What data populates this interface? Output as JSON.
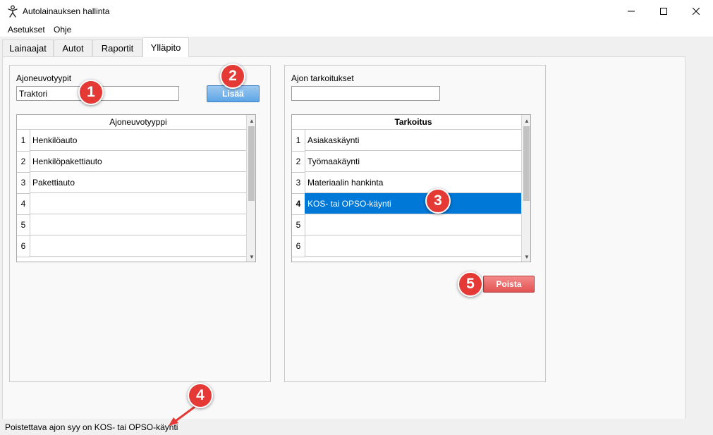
{
  "window": {
    "title": "Autolainauksen hallinta",
    "icon": "person-icon",
    "controls": {
      "minimize": "—",
      "maximize": "☐",
      "close": "✕"
    }
  },
  "menu": {
    "settings": "Asetukset",
    "help": "Ohje"
  },
  "tabs": [
    "Lainaajat",
    "Autot",
    "Raportit",
    "Ylläpito"
  ],
  "active_tab": "Ylläpito",
  "left_panel": {
    "label": "Ajoneuvotyypit",
    "input_value": "Traktori",
    "add_button": "Lisää",
    "grid": {
      "column_header": "Ajoneuvotyyppi",
      "rows": [
        {
          "num": "1",
          "value": "Henkilöauto"
        },
        {
          "num": "2",
          "value": "Henkilöpakettiauto"
        },
        {
          "num": "3",
          "value": "Pakettiauto"
        },
        {
          "num": "4",
          "value": ""
        },
        {
          "num": "5",
          "value": ""
        },
        {
          "num": "6",
          "value": ""
        }
      ]
    }
  },
  "right_panel": {
    "label": "Ajon tarkoitukset",
    "input_value": "",
    "remove_button": "Poista",
    "grid": {
      "column_header": "Tarkoitus",
      "selected_row": "4",
      "rows": [
        {
          "num": "1",
          "value": "Asiakaskäynti"
        },
        {
          "num": "2",
          "value": "Työmaakäynti"
        },
        {
          "num": "3",
          "value": "Materiaalin hankinta"
        },
        {
          "num": "4",
          "value": "KOS- tai OPSO-käynti"
        },
        {
          "num": "5",
          "value": ""
        },
        {
          "num": "6",
          "value": ""
        }
      ]
    }
  },
  "status_bar": {
    "text": "Poistettava ajon syy on KOS- tai OPSO-käynti"
  },
  "annotations": [
    "1",
    "2",
    "3",
    "4",
    "5"
  ],
  "colors": {
    "annotation": "#e53935",
    "selection": "#0078d7",
    "add_button": "#5da5e6",
    "remove_button": "#e25252"
  }
}
